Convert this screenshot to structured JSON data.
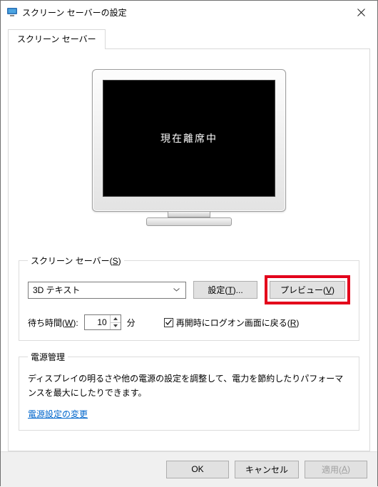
{
  "window": {
    "title": "スクリーン セーバーの設定"
  },
  "tab": {
    "label": "スクリーン セーバー"
  },
  "preview": {
    "screen_text": "現在離席中"
  },
  "saver_group": {
    "legend_pre": "スクリーン セーバー(",
    "legend_hot": "S",
    "legend_post": ")",
    "selected": "3D テキスト",
    "settings_pre": "設定(",
    "settings_hot": "T",
    "settings_post": ")...",
    "preview_pre": "プレビュー(",
    "preview_hot": "V",
    "preview_post": ")",
    "wait_label_pre": "待ち時間(",
    "wait_label_hot": "W",
    "wait_label_post": "):",
    "wait_value": "10",
    "wait_unit": "分",
    "resume_pre": "再開時にログオン画面に戻る(",
    "resume_hot": "R",
    "resume_post": ")",
    "resume_checked": true
  },
  "power_group": {
    "legend": "電源管理",
    "desc": "ディスプレイの明るさや他の電源の設定を調整して、電力を節約したりパフォーマンスを最大にしたりできます。",
    "link": "電源設定の変更"
  },
  "footer": {
    "ok": "OK",
    "cancel": "キャンセル",
    "apply_pre": "適用(",
    "apply_hot": "A",
    "apply_post": ")"
  }
}
